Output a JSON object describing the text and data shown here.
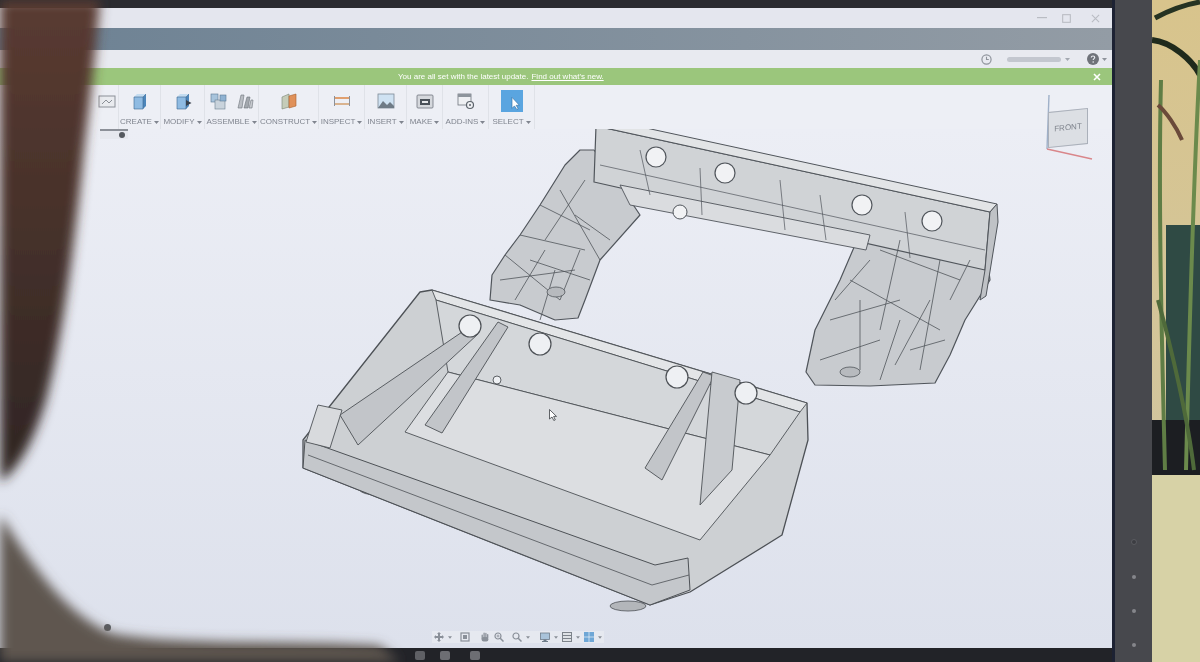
{
  "banner": {
    "message": "You are all set with the latest update.",
    "link": "Find out what's new."
  },
  "toolbar": {
    "groups": [
      {
        "label": "CREATE"
      },
      {
        "label": "MODIFY"
      },
      {
        "label": "ASSEMBLE"
      },
      {
        "label": "CONSTRUCT"
      },
      {
        "label": "INSPECT"
      },
      {
        "label": "INSERT"
      },
      {
        "label": "MAKE"
      },
      {
        "label": "ADD-INS"
      },
      {
        "label": "SELECT"
      }
    ]
  },
  "view_cube": {
    "face": "FRONT"
  }
}
